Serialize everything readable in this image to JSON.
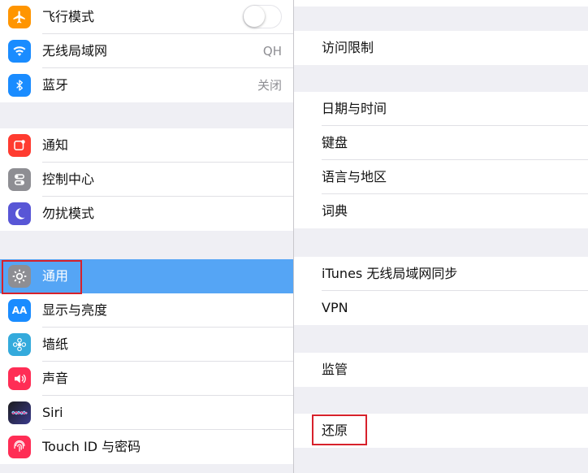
{
  "left": {
    "group1": [
      {
        "label": "飞行模式",
        "icon": "airplane-icon",
        "color": "#ff9500",
        "toggle": false
      },
      {
        "label": "无线局域网",
        "icon": "wifi-icon",
        "color": "#1a8cff",
        "value": "QH"
      },
      {
        "label": "蓝牙",
        "icon": "bluetooth-icon",
        "color": "#1a8cff",
        "value": "关闭"
      }
    ],
    "group2": [
      {
        "label": "通知",
        "icon": "notification-icon",
        "color": "#ff3b30"
      },
      {
        "label": "控制中心",
        "icon": "control-center-icon",
        "color": "#8e8e93"
      },
      {
        "label": "勿扰模式",
        "icon": "moon-icon",
        "color": "#5856d6"
      }
    ],
    "group3": [
      {
        "label": "通用",
        "icon": "gear-icon",
        "color": "#8e8e93",
        "selected": true
      },
      {
        "label": "显示与亮度",
        "icon": "display-brightness-icon",
        "color": "#1a8cff"
      },
      {
        "label": "墙纸",
        "icon": "wallpaper-icon",
        "color": "#34aadc"
      },
      {
        "label": "声音",
        "icon": "speaker-icon",
        "color": "#ff2d55"
      },
      {
        "label": "Siri",
        "icon": "siri-icon",
        "color": "#1c1c1e"
      },
      {
        "label": "Touch ID 与密码",
        "icon": "fingerprint-icon",
        "color": "#ff2d55"
      }
    ]
  },
  "right": {
    "group_restrictions": [
      "访问限制"
    ],
    "group_datetime": [
      "日期与时间",
      "键盘",
      "语言与地区",
      "词典"
    ],
    "group_itunes": [
      "iTunes 无线局域网同步",
      "VPN"
    ],
    "group_supervision": [
      "监管"
    ],
    "group_reset": [
      "还原"
    ]
  },
  "colors": {
    "selected_row": "#55a5f5",
    "highlight_box": "#d7212b",
    "background": "#efeff4"
  }
}
